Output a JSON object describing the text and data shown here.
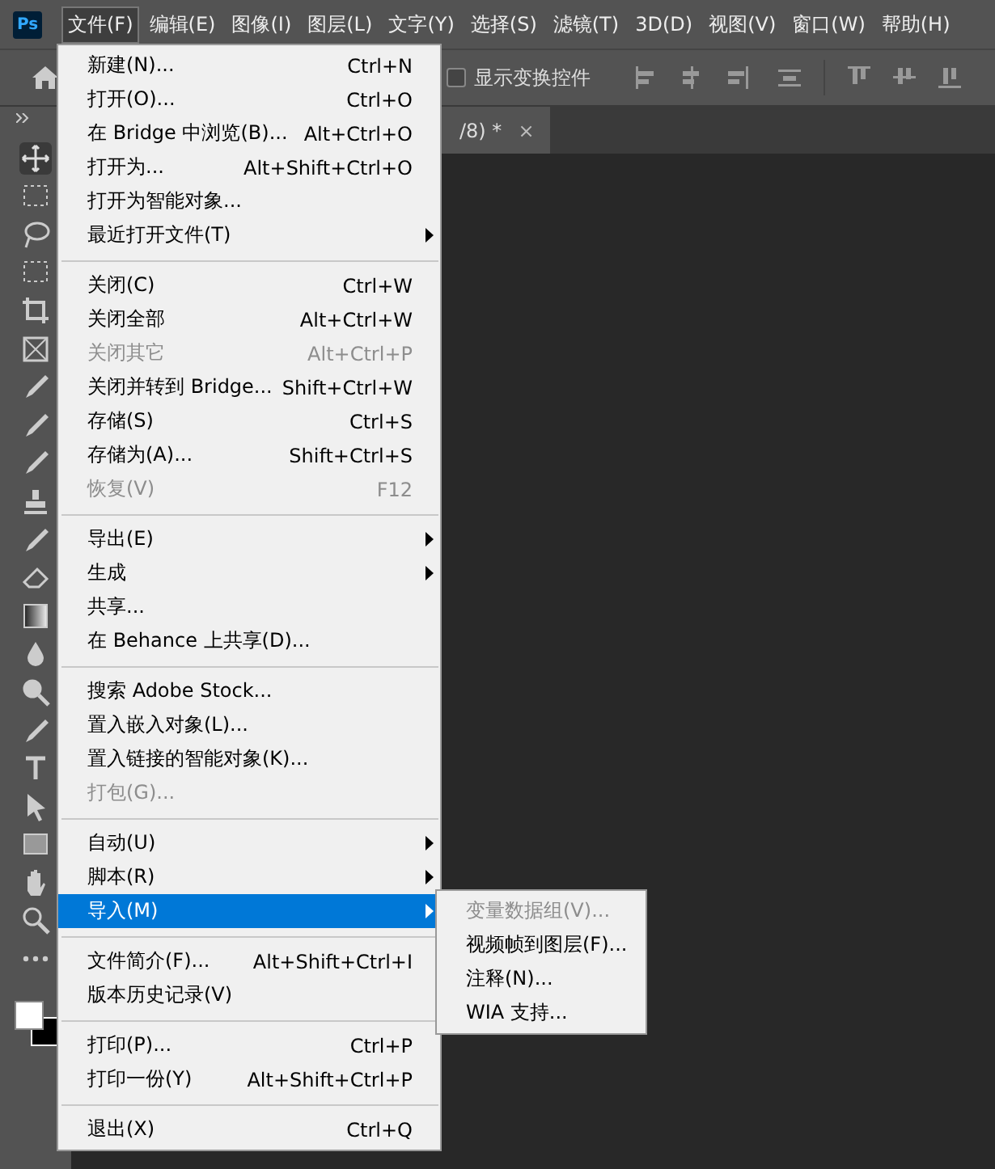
{
  "logo": "Ps",
  "menubar": [
    {
      "label": "文件(F)",
      "selected": true
    },
    {
      "label": "编辑(E)",
      "selected": false
    },
    {
      "label": "图像(I)",
      "selected": false
    },
    {
      "label": "图层(L)",
      "selected": false
    },
    {
      "label": "文字(Y)",
      "selected": false
    },
    {
      "label": "选择(S)",
      "selected": false
    },
    {
      "label": "滤镜(T)",
      "selected": false
    },
    {
      "label": "3D(D)",
      "selected": false
    },
    {
      "label": "视图(V)",
      "selected": false
    },
    {
      "label": "窗口(W)",
      "selected": false
    },
    {
      "label": "帮助(H)",
      "selected": false
    }
  ],
  "options_bar": {
    "show_transform_controls": {
      "label": "显示变换控件",
      "checked": false
    }
  },
  "document_tab": {
    "title": "/8) *",
    "close": "×"
  },
  "file_menu": [
    {
      "kind": "item",
      "label": "新建(N)...",
      "shortcut": "Ctrl+N",
      "disabled": false,
      "submenu": false,
      "selected": false
    },
    {
      "kind": "item",
      "label": "打开(O)...",
      "shortcut": "Ctrl+O",
      "disabled": false,
      "submenu": false,
      "selected": false
    },
    {
      "kind": "item",
      "label": "在 Bridge 中浏览(B)...",
      "shortcut": "Alt+Ctrl+O",
      "disabled": false,
      "submenu": false,
      "selected": false
    },
    {
      "kind": "item",
      "label": "打开为...",
      "shortcut": "Alt+Shift+Ctrl+O",
      "disabled": false,
      "submenu": false,
      "selected": false
    },
    {
      "kind": "item",
      "label": "打开为智能对象...",
      "disabled": false,
      "submenu": false,
      "selected": false
    },
    {
      "kind": "item",
      "label": "最近打开文件(T)",
      "disabled": false,
      "submenu": true,
      "selected": false
    },
    {
      "kind": "separator"
    },
    {
      "kind": "item",
      "label": "关闭(C)",
      "shortcut": "Ctrl+W",
      "disabled": false,
      "submenu": false,
      "selected": false
    },
    {
      "kind": "item",
      "label": "关闭全部",
      "shortcut": "Alt+Ctrl+W",
      "disabled": false,
      "submenu": false,
      "selected": false
    },
    {
      "kind": "item",
      "label": "关闭其它",
      "shortcut": "Alt+Ctrl+P",
      "disabled": true,
      "submenu": false,
      "selected": false
    },
    {
      "kind": "item",
      "label": "关闭并转到 Bridge...",
      "shortcut": "Shift+Ctrl+W",
      "disabled": false,
      "submenu": false,
      "selected": false
    },
    {
      "kind": "item",
      "label": "存储(S)",
      "shortcut": "Ctrl+S",
      "disabled": false,
      "submenu": false,
      "selected": false
    },
    {
      "kind": "item",
      "label": "存储为(A)...",
      "shortcut": "Shift+Ctrl+S",
      "disabled": false,
      "submenu": false,
      "selected": false
    },
    {
      "kind": "item",
      "label": "恢复(V)",
      "shortcut": "F12",
      "disabled": true,
      "submenu": false,
      "selected": false
    },
    {
      "kind": "separator"
    },
    {
      "kind": "item",
      "label": "导出(E)",
      "disabled": false,
      "submenu": true,
      "selected": false
    },
    {
      "kind": "item",
      "label": "生成",
      "disabled": false,
      "submenu": true,
      "selected": false
    },
    {
      "kind": "item",
      "label": "共享...",
      "disabled": false,
      "submenu": false,
      "selected": false
    },
    {
      "kind": "item",
      "label": "在 Behance 上共享(D)...",
      "disabled": false,
      "submenu": false,
      "selected": false
    },
    {
      "kind": "separator"
    },
    {
      "kind": "item",
      "label": "搜索 Adobe Stock...",
      "disabled": false,
      "submenu": false,
      "selected": false
    },
    {
      "kind": "item",
      "label": "置入嵌入对象(L)...",
      "disabled": false,
      "submenu": false,
      "selected": false
    },
    {
      "kind": "item",
      "label": "置入链接的智能对象(K)...",
      "disabled": false,
      "submenu": false,
      "selected": false
    },
    {
      "kind": "item",
      "label": "打包(G)...",
      "disabled": true,
      "submenu": false,
      "selected": false
    },
    {
      "kind": "separator"
    },
    {
      "kind": "item",
      "label": "自动(U)",
      "disabled": false,
      "submenu": true,
      "selected": false
    },
    {
      "kind": "item",
      "label": "脚本(R)",
      "disabled": false,
      "submenu": true,
      "selected": false
    },
    {
      "kind": "item",
      "label": "导入(M)",
      "disabled": false,
      "submenu": true,
      "selected": true
    },
    {
      "kind": "separator"
    },
    {
      "kind": "item",
      "label": "文件简介(F)...",
      "shortcut": "Alt+Shift+Ctrl+I",
      "disabled": false,
      "submenu": false,
      "selected": false
    },
    {
      "kind": "item",
      "label": "版本历史记录(V)",
      "disabled": false,
      "submenu": false,
      "selected": false
    },
    {
      "kind": "separator"
    },
    {
      "kind": "item",
      "label": "打印(P)...",
      "shortcut": "Ctrl+P",
      "disabled": false,
      "submenu": false,
      "selected": false
    },
    {
      "kind": "item",
      "label": "打印一份(Y)",
      "shortcut": "Alt+Shift+Ctrl+P",
      "disabled": false,
      "submenu": false,
      "selected": false
    },
    {
      "kind": "separator"
    },
    {
      "kind": "item",
      "label": "退出(X)",
      "shortcut": "Ctrl+Q",
      "disabled": false,
      "submenu": false,
      "selected": false
    }
  ],
  "import_submenu": [
    {
      "label": "变量数据组(V)...",
      "disabled": true
    },
    {
      "label": "视频帧到图层(F)...",
      "disabled": false
    },
    {
      "label": "注释(N)...",
      "disabled": false
    },
    {
      "label": "WIA 支持...",
      "disabled": false
    }
  ]
}
